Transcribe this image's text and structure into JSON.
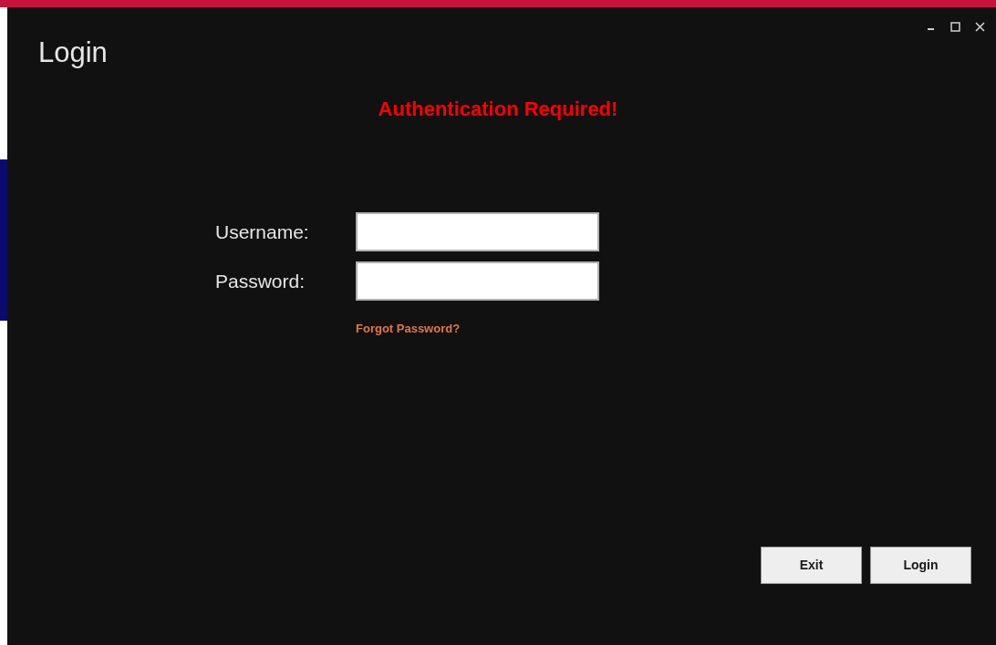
{
  "window": {
    "title": "Login",
    "controls": [
      {
        "kind": "minimize"
      },
      {
        "kind": "maximize"
      },
      {
        "kind": "close"
      }
    ]
  },
  "heading": "Authentication Required!",
  "fields": [
    {
      "label": "Username:"
    },
    {
      "label": "Password:"
    }
  ],
  "forgot_link": "Forgot Password?",
  "buttons": [
    {
      "label": "Exit"
    },
    {
      "label": "Login"
    }
  ]
}
